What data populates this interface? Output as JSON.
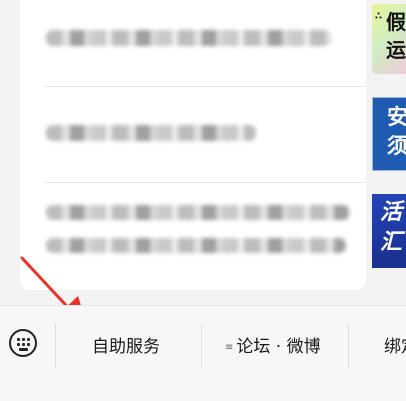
{
  "menu": {
    "tab1_label": "自助服务",
    "tab2_label": "论坛 · 微博",
    "tab3_label": "绑定",
    "tab2_menu_glyph": "≡"
  },
  "thumbs": {
    "t1_line1": "假",
    "t1_line2": "运",
    "t2_line1": "安",
    "t2_line2": "须",
    "t3_line1": "活",
    "t3_line2": "汇"
  },
  "icons": {
    "keyboard": "keyboard-icon",
    "arrow": "red-arrow-annotation"
  },
  "colors": {
    "annotation_arrow": "#e8322a",
    "thumb2_bg": "#1f5bb0",
    "thumb3_bg": "#1e3da8"
  }
}
